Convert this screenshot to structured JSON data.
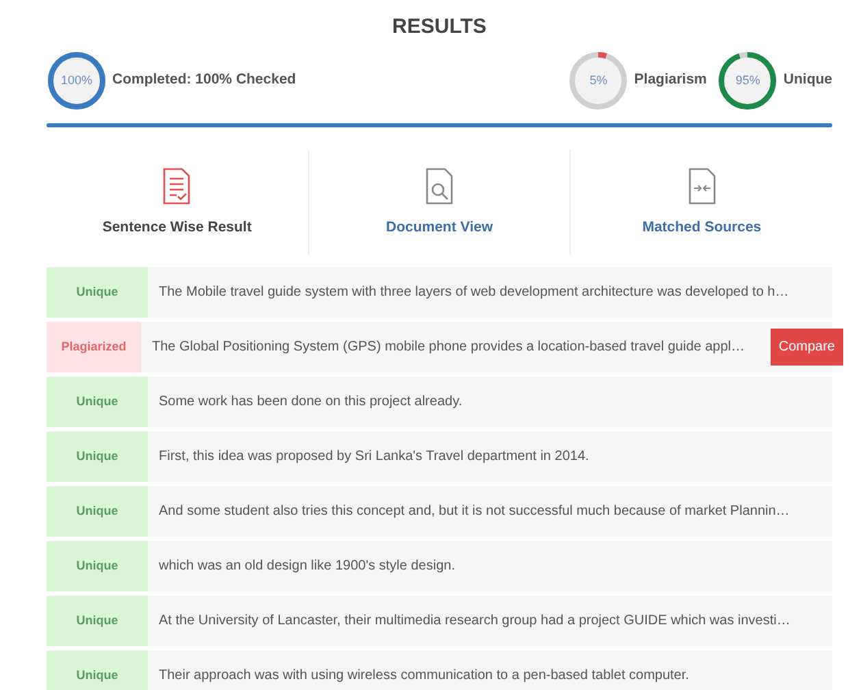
{
  "title": "RESULTS",
  "stats": [
    {
      "reading": "100%",
      "label": "Completed: 100% Checked"
    },
    {
      "reading": "5%",
      "label": "Plagiarism"
    },
    {
      "reading": "95%",
      "label": "Unique"
    }
  ],
  "tabs": [
    {
      "label": "Sentence Wise Result",
      "selected": true
    },
    {
      "label": "Document View",
      "selected": false
    },
    {
      "label": "Matched Sources",
      "selected": false
    }
  ],
  "sentences": [
    {
      "kind": "unique",
      "tag": "Unique",
      "text": "The Mobile travel guide system with three layers of web development architecture was developed to h…"
    },
    {
      "kind": "plagiarized",
      "tag": "Plagiarized",
      "text": "The Global Positioning System (GPS) mobile phone provides a location-based travel guide appl…",
      "action": "Compare"
    },
    {
      "kind": "unique",
      "tag": "Unique",
      "text": "Some work has been done on this project already."
    },
    {
      "kind": "unique",
      "tag": "Unique",
      "text": "First, this idea was proposed by Sri Lanka's Travel department in 2014."
    },
    {
      "kind": "unique",
      "tag": "Unique",
      "text": "And some student also tries this concept and, but it is not successful much because of market Plannin…"
    },
    {
      "kind": "unique",
      "tag": "Unique",
      "text": "which was an old design like 1900's style design."
    },
    {
      "kind": "unique",
      "tag": "Unique",
      "text": "At the University of Lancaster, their multimedia research group had a project GUIDE which was investi…"
    },
    {
      "kind": "unique",
      "tag": "Unique",
      "text": "Their approach was with using wireless communication to a pen-based tablet computer."
    }
  ]
}
